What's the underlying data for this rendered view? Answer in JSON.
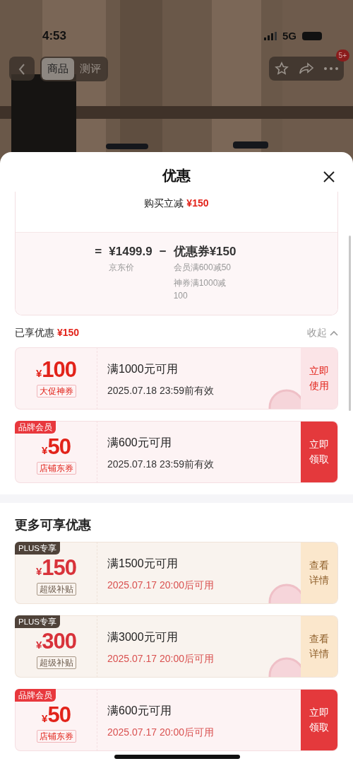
{
  "status_bar": {
    "time": "4:53",
    "network": "5G"
  },
  "nav": {
    "tabs": [
      {
        "label": "商品",
        "selected": true
      },
      {
        "label": "测评",
        "selected": false
      }
    ],
    "badge": "5+"
  },
  "sheet": {
    "title": "优惠"
  },
  "summary": {
    "reduction_label": "购买立减",
    "reduction_amount": "¥150",
    "equals": "=",
    "price": "¥1499.9",
    "price_label": "京东价",
    "minus": "−",
    "discount": "优惠券¥150",
    "discount_items": [
      "会员满600减50",
      "神券满1000减100"
    ]
  },
  "enjoyed": {
    "label": "已享优惠",
    "amount": "¥150",
    "toggle": "收起",
    "expanded": true
  },
  "coupons": [
    {
      "kind": "red",
      "currency": "¥",
      "amount": "100",
      "type_label": "大促神券",
      "condition": "满1000元可用",
      "validity": "2025.07.18 23:59前有效",
      "upcoming": false,
      "action": "立即使用",
      "action_filled": false,
      "stamped": true
    },
    {
      "kind": "red",
      "tag": "品牌会员",
      "currency": "¥",
      "amount": "50",
      "type_label": "店铺东券",
      "condition": "满600元可用",
      "validity": "2025.07.18 23:59前有效",
      "upcoming": false,
      "action": "立即领取",
      "action_filled": true,
      "stamped": false
    }
  ],
  "more": {
    "title": "更多可享优惠",
    "coupons": [
      {
        "kind": "plus",
        "tag": "PLUS专享",
        "currency": "¥",
        "amount": "150",
        "type_label": "超级补贴",
        "condition": "满1500元可用",
        "validity": "2025.07.17 20:00后可用",
        "upcoming": true,
        "action": "查看详情",
        "action_filled": false,
        "stamped": true
      },
      {
        "kind": "plus",
        "tag": "PLUS专享",
        "currency": "¥",
        "amount": "300",
        "type_label": "超级补贴",
        "condition": "满3000元可用",
        "validity": "2025.07.17 20:00后可用",
        "upcoming": true,
        "action": "查看详情",
        "action_filled": false,
        "stamped": true
      },
      {
        "kind": "red",
        "tag": "品牌会员",
        "currency": "¥",
        "amount": "50",
        "type_label": "店铺东券",
        "condition": "满600元可用",
        "validity": "2025.07.17 20:00后可用",
        "upcoming": true,
        "action": "立即领取",
        "action_filled": true,
        "stamped": false
      }
    ]
  }
}
